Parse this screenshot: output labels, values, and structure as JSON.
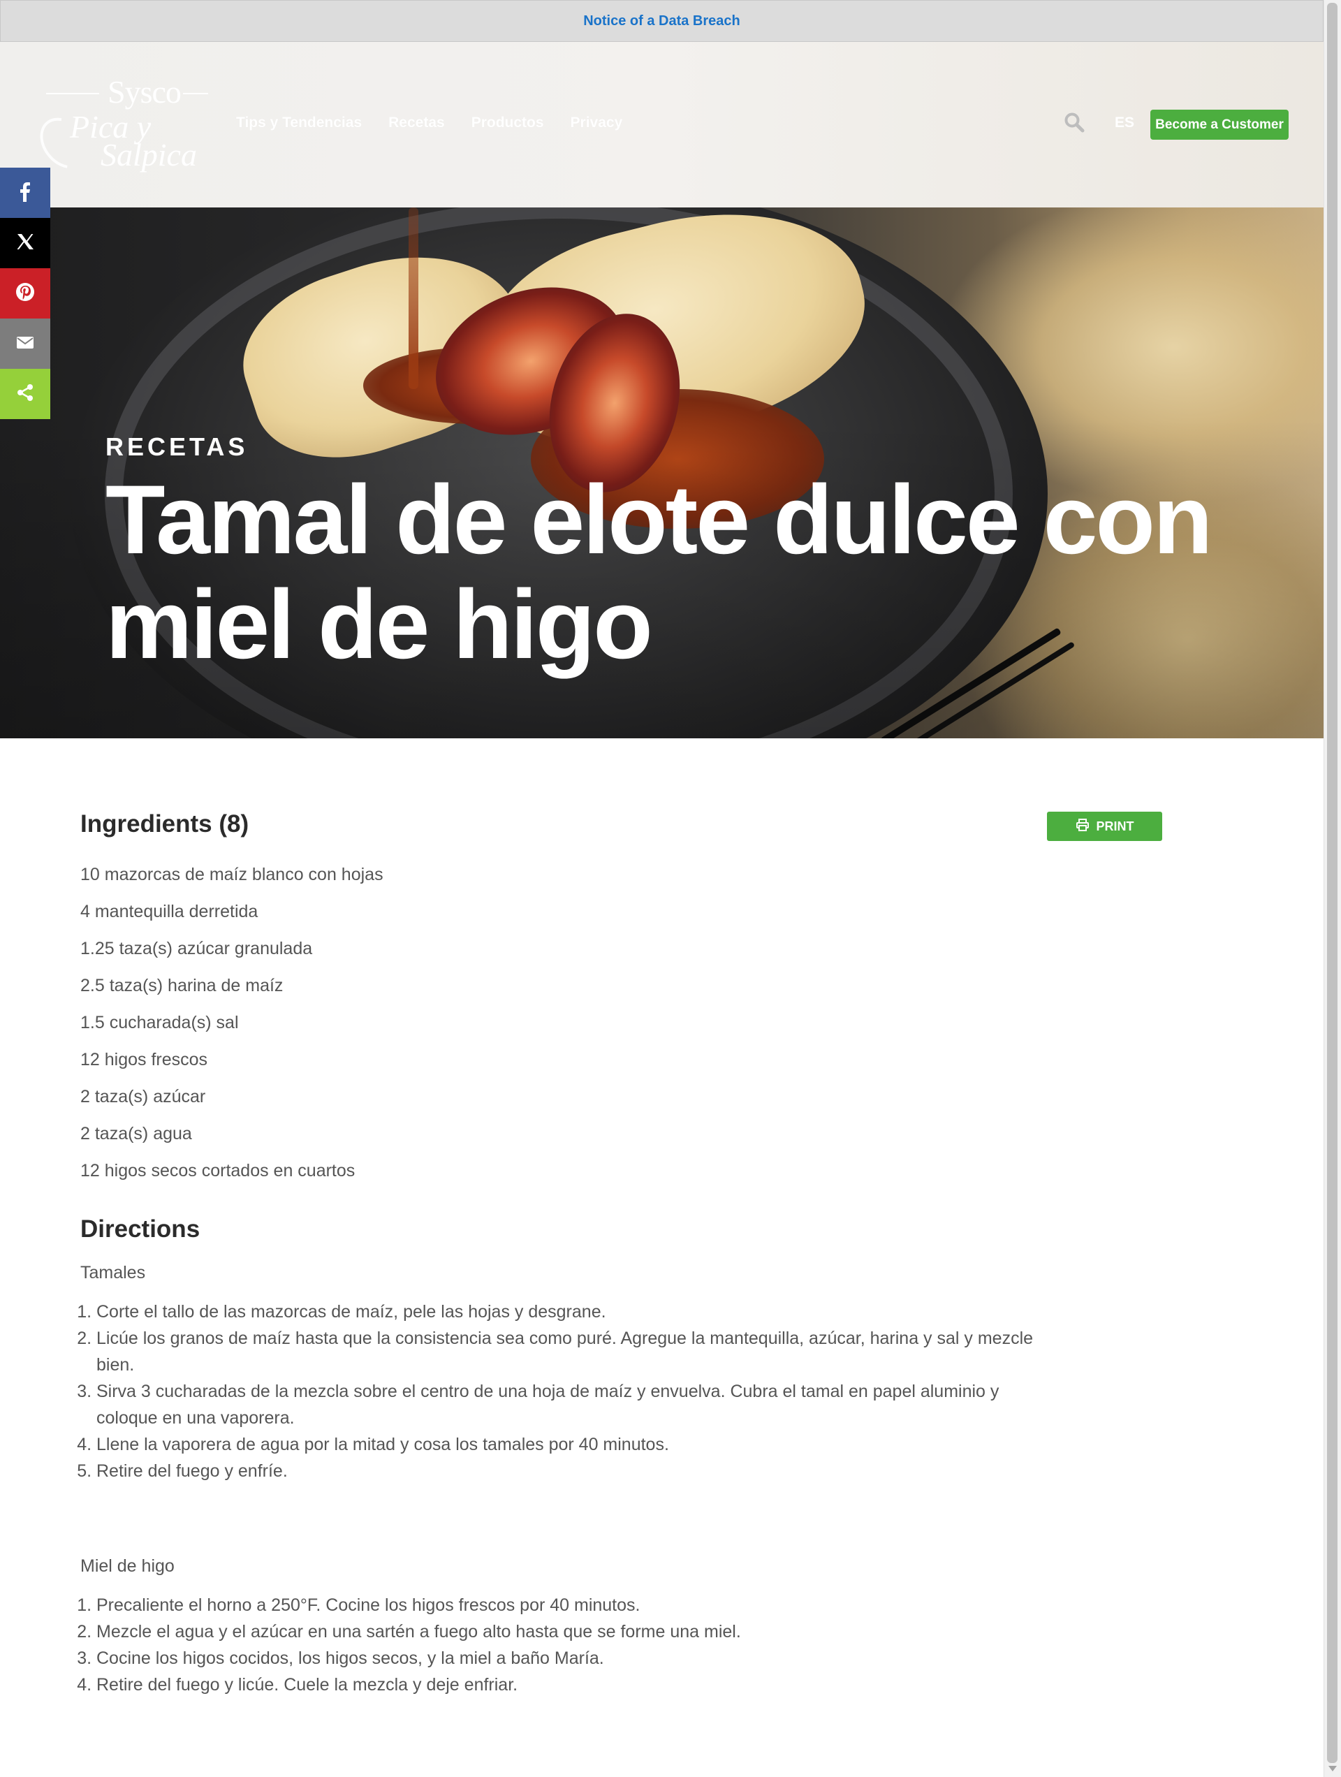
{
  "notice": {
    "text": "Notice of a Data Breach"
  },
  "logo": {
    "line1": "Sysco",
    "line2": "Pica y",
    "line3": "Salpica"
  },
  "nav": {
    "items": [
      "Tips y Tendencias",
      "Recetas",
      "Productos",
      "Privacy"
    ]
  },
  "header": {
    "lang": "ES",
    "cta": "Become a Customer",
    "search_icon": "search-icon"
  },
  "social": {
    "icons": [
      "facebook-icon",
      "x-icon",
      "pinterest-icon",
      "email-icon",
      "share-icon"
    ],
    "colors": [
      "#3b5998",
      "#000000",
      "#cb2027",
      "#7d7d7d",
      "#95d03a"
    ]
  },
  "hero": {
    "eyebrow": "RECETAS",
    "title": "Tamal de elote dulce con miel de higo"
  },
  "ingredients": {
    "heading": "Ingredients (8)",
    "print_label": "PRINT",
    "items": [
      "10 mazorcas de maíz blanco con hojas",
      "4 mantequilla derretida",
      "1.25 taza(s) azúcar granulada",
      "2.5 taza(s) harina de maíz",
      "1.5 cucharada(s) sal",
      "12 higos frescos",
      "2 taza(s) azúcar",
      "2 taza(s) agua",
      "12 higos secos cortados en cuartos"
    ]
  },
  "directions": {
    "heading": "Directions",
    "sections": [
      {
        "title": "Tamales",
        "steps": [
          "Corte el tallo de las mazorcas de maíz, pele las hojas y desgrane.",
          "Licúe los granos de maíz hasta que la consistencia sea como puré. Agregue la mantequilla, azúcar, harina y sal y mezcle bien.",
          "Sirva 3 cucharadas de la mezcla sobre el centro de una hoja de maíz y envuelva. Cubra el tamal en papel aluminio y coloque en una vaporera.",
          "Llene la vaporera de agua por la mitad y cosa los tamales por 40 minutos.",
          "Retire del fuego y enfríe."
        ]
      },
      {
        "title": "Miel de higo",
        "steps": [
          "Precaliente el horno a 250°F. Cocine los higos frescos por 40 minutos.",
          "Mezcle el agua y el azúcar en una sartén a fuego alto hasta que se forme una miel.",
          "Cocine los higos cocidos, los higos secos, y la miel a baño María.",
          "Retire del fuego y licúe. Cuele la mezcla y deje enfriar."
        ]
      }
    ]
  },
  "colors": {
    "accent_green": "#4cae3f",
    "link_blue": "#1a73c9"
  }
}
